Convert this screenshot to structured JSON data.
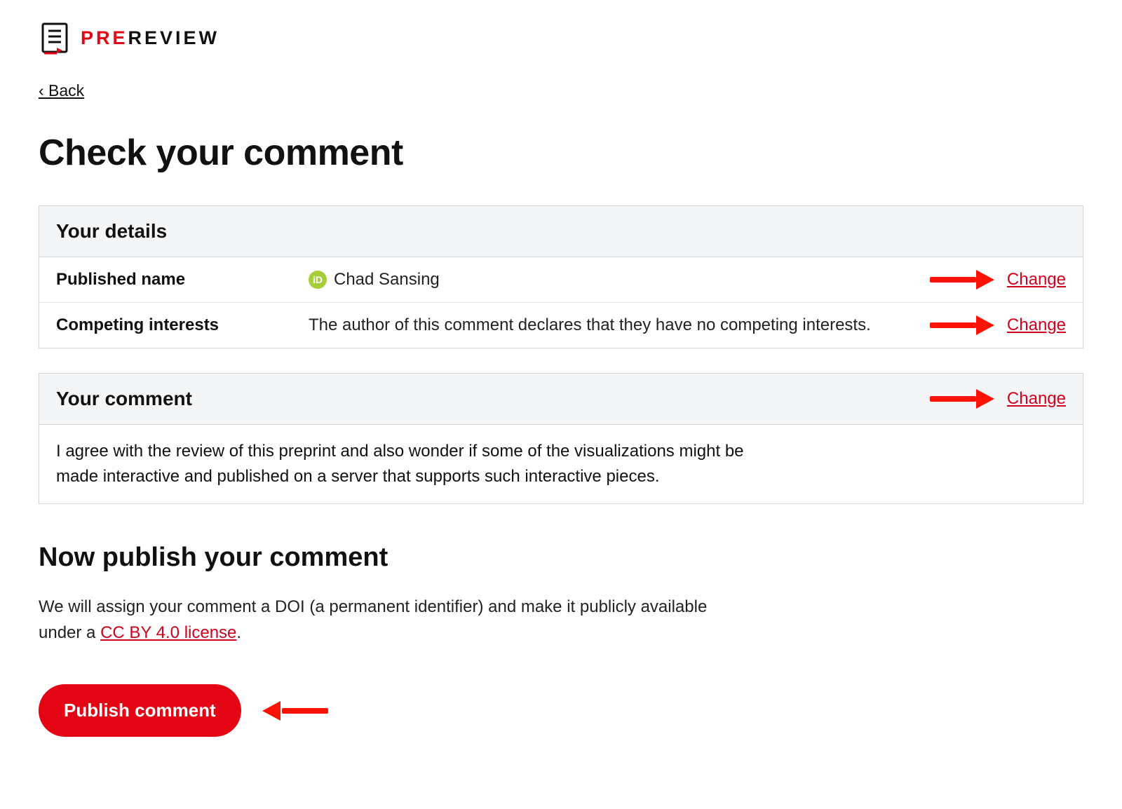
{
  "logo": {
    "pre": "PRE",
    "review": "REVIEW"
  },
  "nav": {
    "back_label": "‹ Back"
  },
  "heading": "Check your comment",
  "details": {
    "title": "Your details",
    "rows": [
      {
        "key": "Published name",
        "value": "Chad Sansing",
        "orcid_glyph": "iD",
        "change_label": "Change"
      },
      {
        "key": "Competing interests",
        "value": "The author of this comment declares that they have no competing interests.",
        "change_label": "Change"
      }
    ]
  },
  "comment": {
    "title": "Your comment",
    "change_label": "Change",
    "body": "I agree with the review of this preprint and also wonder if some of the visualizations might be made interactive and published on a server that supports such interactive pieces."
  },
  "publish": {
    "heading": "Now publish your comment",
    "desc_pre": "We will assign your comment a DOI (a permanent identifier) and make it publicly available under a ",
    "cc_label": "CC BY 4.0 license",
    "desc_post": ".",
    "button_label": "Publish comment"
  }
}
